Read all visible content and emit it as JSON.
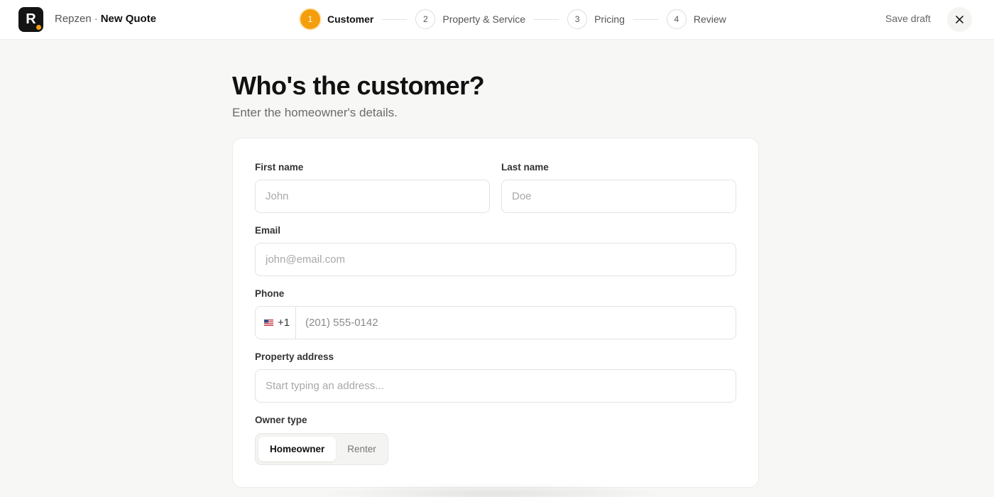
{
  "header": {
    "logo_letter": "R",
    "brand": "Repzen",
    "separator": "·",
    "page_title": "New Quote",
    "save_draft": "Save draft",
    "accent_color": "#f59e0b"
  },
  "stepper": {
    "current_step": 1,
    "steps": [
      {
        "number": "1",
        "label": "Customer"
      },
      {
        "number": "2",
        "label": "Property & Service"
      },
      {
        "number": "3",
        "label": "Pricing"
      },
      {
        "number": "4",
        "label": "Review"
      }
    ]
  },
  "main": {
    "title": "Who's the customer?",
    "subtitle": "Enter the homeowner's details."
  },
  "form": {
    "first_name": {
      "label": "First name",
      "placeholder": "John",
      "value": ""
    },
    "last_name": {
      "label": "Last name",
      "placeholder": "Doe",
      "value": ""
    },
    "email": {
      "label": "Email",
      "placeholder": "john@email.com",
      "value": ""
    },
    "phone": {
      "label": "Phone",
      "country_flag": "us-flag-icon",
      "dial_code": "+1",
      "placeholder": "(201) 555-0142",
      "value": ""
    },
    "address": {
      "label": "Property address",
      "placeholder": "Start typing an address...",
      "value": ""
    },
    "owner_type": {
      "label": "Owner type",
      "options": [
        "Homeowner",
        "Renter"
      ],
      "selected": "Homeowner"
    }
  }
}
